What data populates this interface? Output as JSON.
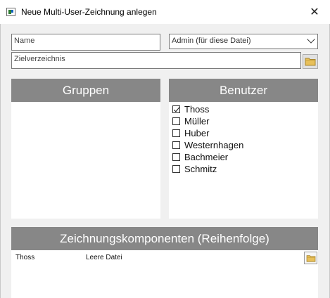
{
  "window": {
    "title": "Neue Multi-User-Zeichnung anlegen",
    "close_glyph": "✕"
  },
  "form": {
    "name_placeholder": "Name",
    "role_selected": "Admin (für diese Datei)",
    "target_dir_placeholder": "Zielverzeichnis"
  },
  "groups_panel": {
    "header": "Gruppen"
  },
  "users_panel": {
    "header": "Benutzer",
    "users": [
      {
        "label": "Thoss",
        "checked": true
      },
      {
        "label": "Müller",
        "checked": false
      },
      {
        "label": "Huber",
        "checked": false
      },
      {
        "label": "Westernhagen",
        "checked": false
      },
      {
        "label": "Bachmeier",
        "checked": false
      },
      {
        "label": "Schmitz",
        "checked": false
      }
    ]
  },
  "components_panel": {
    "header": "Zeichnungskomponenten (Reihenfolge)",
    "rows": [
      {
        "user": "Thoss",
        "file": "Leere Datei"
      }
    ]
  },
  "icons": {
    "app": "app-window-icon",
    "folder": "folder-icon",
    "dropdown": "chevron-down-icon",
    "close": "close-icon"
  },
  "colors": {
    "panel_header": "#878787",
    "folder": "#e8c05a"
  }
}
